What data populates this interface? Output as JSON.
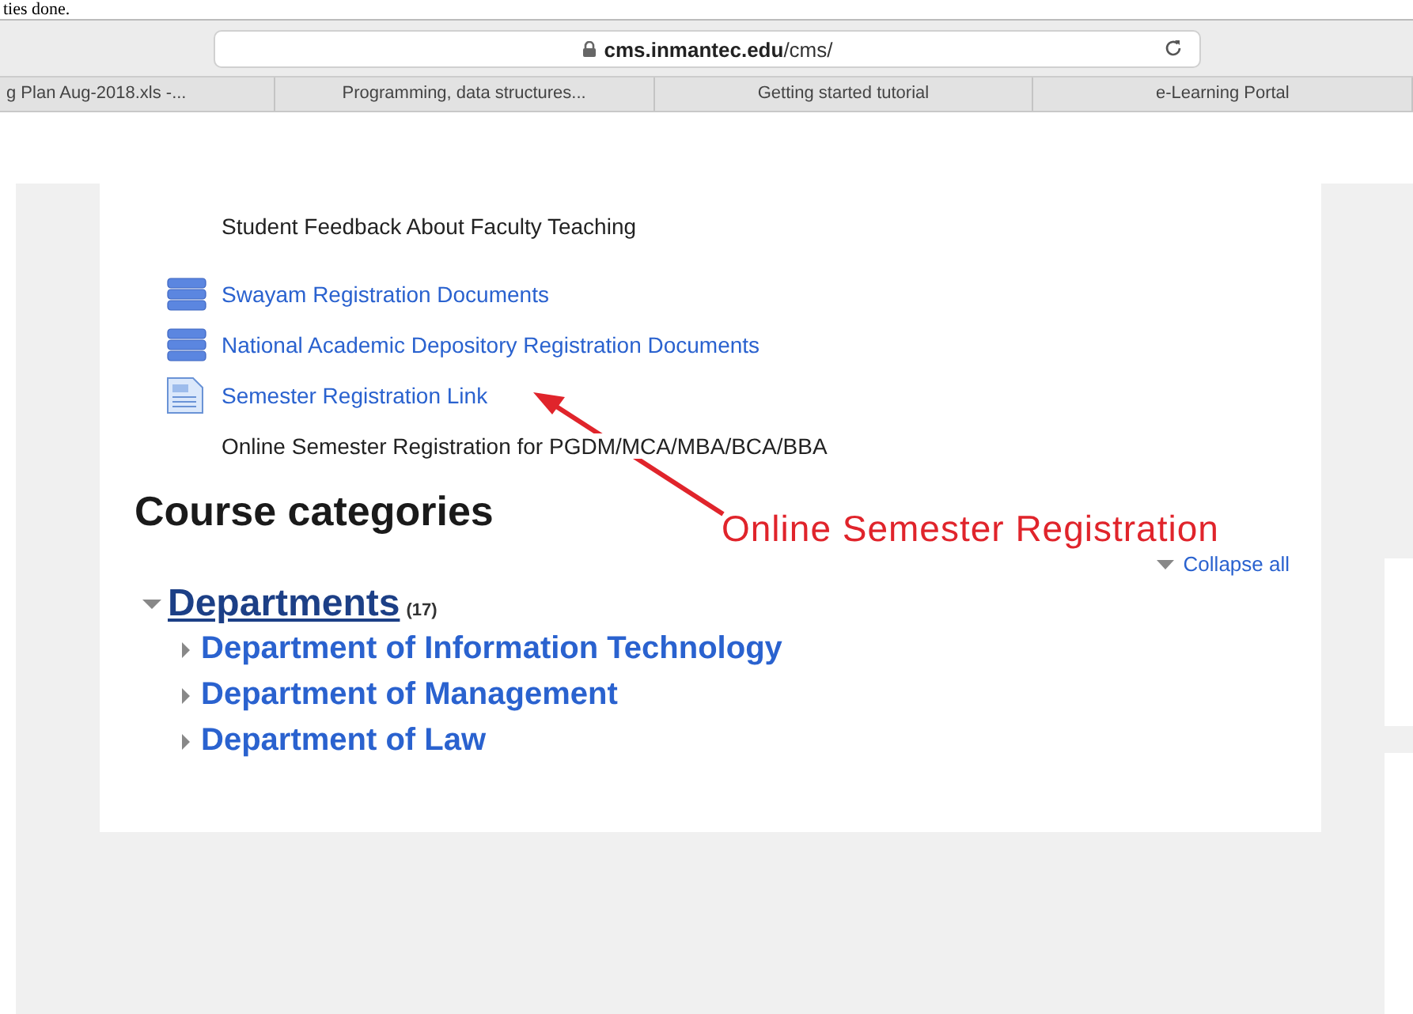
{
  "doc_fragment": "ties done.",
  "browser": {
    "address": {
      "host": "cms.inmantec.edu",
      "path": "/cms/"
    },
    "tabs": [
      {
        "label": "g Plan Aug-2018.xls -...",
        "selected": false
      },
      {
        "label": "Programming, data structures...",
        "selected": false
      },
      {
        "label": "Getting started tutorial",
        "selected": false
      },
      {
        "label": "e-Learning Portal",
        "selected": false
      }
    ]
  },
  "activities": [
    {
      "kind": "text",
      "label": "Student Feedback About Faculty Teaching"
    },
    {
      "kind": "folder",
      "label": "Swayam Registration Documents"
    },
    {
      "kind": "folder",
      "label": "National Academic Depository Registration Documents"
    },
    {
      "kind": "page",
      "label": "Semester Registration Link"
    },
    {
      "kind": "text",
      "label": "Online Semester Registration for PGDM/MCA/MBA/BCA/BBA"
    }
  ],
  "course_categories": {
    "heading": "Course categories",
    "collapse_all": "Collapse all",
    "tree": [
      {
        "label": "Departments",
        "count": "(17)",
        "expanded": true,
        "children": [
          {
            "label": "Department of Information Technology",
            "expanded": false
          },
          {
            "label": "Department of Management",
            "expanded": false
          },
          {
            "label": "Department of Law",
            "expanded": false
          }
        ]
      }
    ]
  },
  "annotation": {
    "label": "Online Semester Registration"
  }
}
